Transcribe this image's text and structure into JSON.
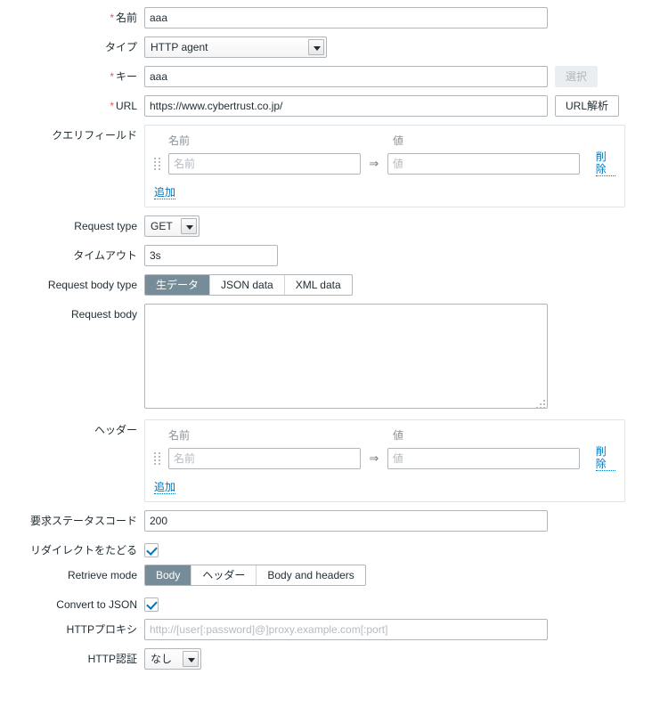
{
  "colors": {
    "required_asterisk": "#e45959",
    "link": "#0275b8",
    "segment_active_bg": "#768d99",
    "checkbox_check": "#0275b8",
    "input_border": "#b1b6bb",
    "box_border": "#dfe4e7",
    "placeholder": "#b5bbc1",
    "text": "#1f2c33"
  },
  "form": {
    "name": {
      "label": "名前",
      "required": "*",
      "value": "aaa"
    },
    "type": {
      "label": "タイプ",
      "value": "HTTP agent"
    },
    "key": {
      "label": "キー",
      "required": "*",
      "value": "aaa",
      "select_button": "選択"
    },
    "url": {
      "label": "URL",
      "required": "*",
      "value": "https://www.cybertrust.co.jp/",
      "parse_button": "URL解析"
    },
    "query_fields": {
      "label": "クエリフィールド",
      "header_name": "名前",
      "header_value": "値",
      "rows": [
        {
          "name_placeholder": "名前",
          "name_value": "",
          "arrow": "⇒",
          "value_placeholder": "値",
          "value_value": "",
          "remove_label": "削除"
        }
      ],
      "add_label": "追加"
    },
    "request_type": {
      "label": "Request type",
      "value": "GET"
    },
    "timeout": {
      "label": "タイムアウト",
      "value": "3s"
    },
    "request_body_type": {
      "label": "Request body type",
      "options": [
        "生データ",
        "JSON data",
        "XML data"
      ],
      "selected": "生データ"
    },
    "request_body": {
      "label": "Request body",
      "value": ""
    },
    "headers": {
      "label": "ヘッダー",
      "header_name": "名前",
      "header_value": "値",
      "rows": [
        {
          "name_placeholder": "名前",
          "name_value": "",
          "arrow": "⇒",
          "value_placeholder": "値",
          "value_value": "",
          "remove_label": "削除"
        }
      ],
      "add_label": "追加"
    },
    "status_codes": {
      "label": "要求ステータスコード",
      "value": "200"
    },
    "follow_redirects": {
      "label": "リダイレクトをたどる",
      "checked": true
    },
    "retrieve_mode": {
      "label": "Retrieve mode",
      "options": [
        "Body",
        "ヘッダー",
        "Body and headers"
      ],
      "selected": "Body"
    },
    "convert_to_json": {
      "label": "Convert to JSON",
      "checked": true
    },
    "http_proxy": {
      "label": "HTTPプロキシ",
      "value": "",
      "placeholder": "http://[user[:password]@]proxy.example.com[:port]"
    },
    "http_auth": {
      "label": "HTTP認証",
      "value": "なし"
    }
  }
}
